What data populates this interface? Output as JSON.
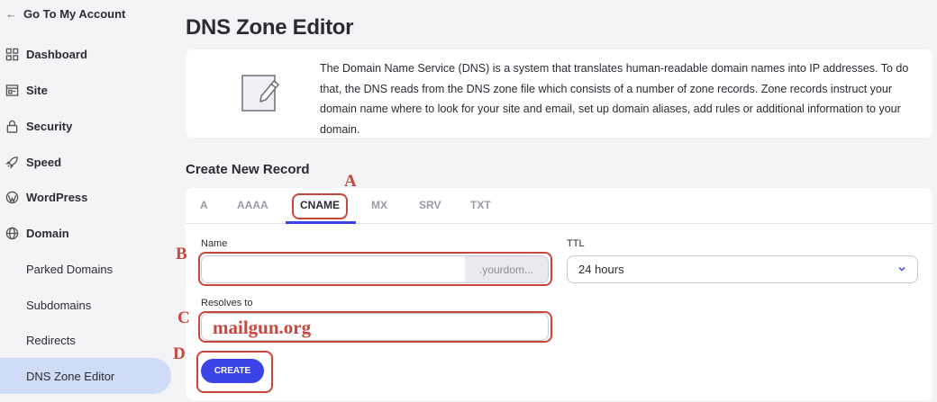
{
  "sidebar": {
    "back_label": "Go To My Account",
    "items": [
      {
        "label": "Dashboard",
        "icon": "grid-icon"
      },
      {
        "label": "Site",
        "icon": "site-icon"
      },
      {
        "label": "Security",
        "icon": "lock-icon"
      },
      {
        "label": "Speed",
        "icon": "rocket-icon"
      },
      {
        "label": "WordPress",
        "icon": "wordpress-icon"
      },
      {
        "label": "Domain",
        "icon": "globe-icon"
      }
    ],
    "sub_items": [
      {
        "label": "Parked Domains"
      },
      {
        "label": "Subdomains"
      },
      {
        "label": "Redirects"
      },
      {
        "label": "DNS Zone Editor",
        "active": true
      }
    ]
  },
  "main": {
    "title": "DNS Zone Editor",
    "info_text": "The Domain Name Service (DNS) is a system that translates human-readable domain names into IP addresses. To do that, the DNS reads from the DNS zone file which consists of a number of zone records. Zone records instruct your domain name where to look for your site and email, set up domain aliases, add rules or additional information to your domain.",
    "section_title": "Create New Record",
    "tabs": [
      {
        "label": "A"
      },
      {
        "label": "AAAA"
      },
      {
        "label": "CNAME",
        "active": true
      },
      {
        "label": "MX"
      },
      {
        "label": "SRV"
      },
      {
        "label": "TXT"
      }
    ],
    "form": {
      "name_label": "Name",
      "name_value": "",
      "name_suffix": ".yourdom...",
      "ttl_label": "TTL",
      "ttl_value": "24 hours",
      "resolves_label": "Resolves to",
      "resolves_value": "mailgun.org",
      "create_label": "CREATE"
    }
  },
  "annotations": {
    "a": "A",
    "b": "B",
    "c": "C",
    "d": "D",
    "color": "#c9463c"
  },
  "colors": {
    "accent": "#3b44e6",
    "active_nav_bg": "#cfdcf8"
  }
}
